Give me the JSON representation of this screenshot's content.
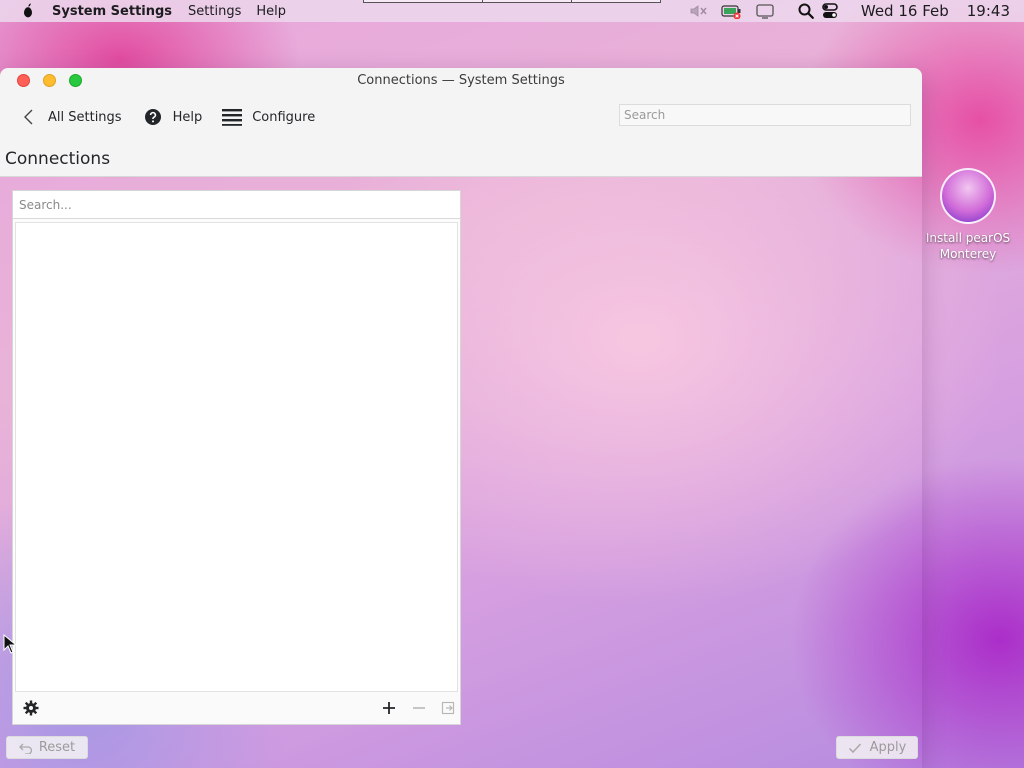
{
  "menubar": {
    "app_name": "System Settings",
    "menus": [
      "Settings",
      "Help"
    ],
    "date": "Wed 16 Feb",
    "time": "19:43"
  },
  "window": {
    "title": "Connections — System Settings",
    "toolbar": {
      "back_label": "All Settings",
      "help_label": "Help",
      "configure_label": "Configure",
      "search_placeholder": "Search"
    },
    "page_title": "Connections",
    "connections": {
      "search_placeholder": "Search...",
      "items": []
    },
    "buttons": {
      "reset": "Reset",
      "apply": "Apply"
    }
  },
  "desktop": {
    "icon_label": "Install pearOS Monterey"
  },
  "colors": {
    "close": "#ff5f57",
    "minimize": "#febc2e",
    "maximize": "#28c840"
  }
}
